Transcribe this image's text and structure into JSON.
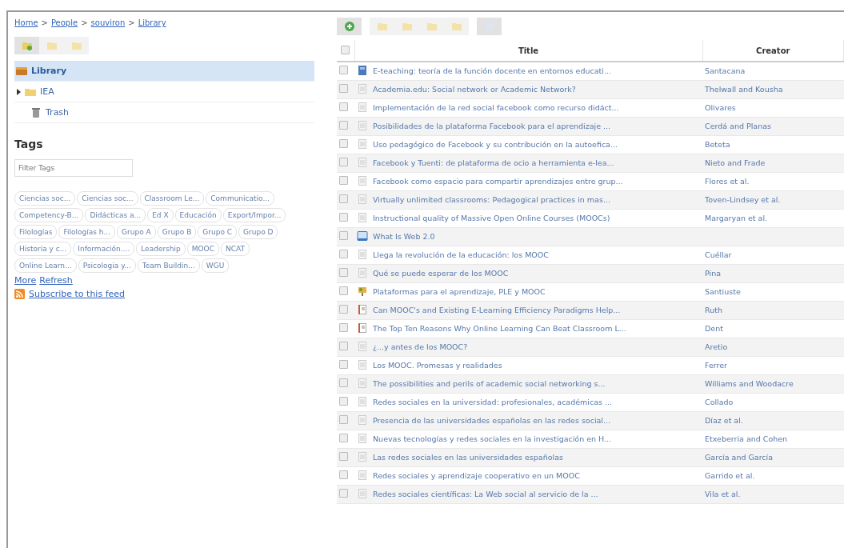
{
  "breadcrumb": {
    "separator": ">",
    "links": [
      "Home",
      "People",
      "souviron",
      "Library"
    ]
  },
  "collections": [
    {
      "label": "Library",
      "kind": "library",
      "selected": true,
      "expandable": false
    },
    {
      "label": "IEA",
      "kind": "folder",
      "selected": false,
      "expandable": true
    },
    {
      "label": "Trash",
      "kind": "trash",
      "selected": false,
      "expandable": false
    }
  ],
  "tags": {
    "heading": "Tags",
    "filter": {
      "placeholder": "Filter Tags"
    },
    "items": [
      "Ciencias soc...",
      "Ciencias soc...",
      "Classroom Le...",
      "Communicatio...",
      "Competency-B...",
      "Didácticas a...",
      "Ed X",
      "Educación",
      "Export/Impor...",
      "Filologías",
      "Filologías h...",
      "Grupo A",
      "Grupo B",
      "Grupo C",
      "Grupo D",
      "Historia y c...",
      "Información....",
      "Leadership",
      "MOOC",
      "NCAT",
      "Online Learn...",
      "Psicologia y...",
      "Team Buildin...",
      "WGU"
    ],
    "links": [
      "More",
      "Refresh"
    ],
    "feed": "Subscribe to this feed"
  },
  "table": {
    "columns": [
      "Title",
      "Creator"
    ],
    "select_all_checked": false,
    "rows": [
      {
        "checked": false,
        "kind": "book",
        "title": "E-teaching: teoría de la función docente en entornos educati...",
        "creator": "Santacana"
      },
      {
        "checked": false,
        "kind": "article",
        "title": "Academia.edu: Social network or Academic Network?",
        "creator": "Thelwall and Kousha"
      },
      {
        "checked": false,
        "kind": "article",
        "title": "Implementación de la red social facebook como recurso didáct...",
        "creator": "Olivares"
      },
      {
        "checked": false,
        "kind": "article",
        "title": "Posibilidades de la plataforma Facebook para el aprendizaje ...",
        "creator": "Cerdá and Planas"
      },
      {
        "checked": false,
        "kind": "article",
        "title": "Uso pedagógico de Facebook y su contribución en la autoefica...",
        "creator": "Beteta"
      },
      {
        "checked": false,
        "kind": "article",
        "title": "Facebook y Tuenti: de plataforma de ocio a herramienta e-lea...",
        "creator": "Nieto and Frade"
      },
      {
        "checked": false,
        "kind": "article",
        "title": "Facebook como espacio para compartir aprendizajes entre grup...",
        "creator": "Flores et al."
      },
      {
        "checked": false,
        "kind": "article",
        "title": "Virtually unlimited classrooms: Pedagogical practices in mas...",
        "creator": "Toven-Lindsey et al."
      },
      {
        "checked": false,
        "kind": "article",
        "title": "Instructional quality of Massive Open Online Courses (MOOCs)",
        "creator": "Margaryan et al."
      },
      {
        "checked": false,
        "kind": "webpage",
        "title": "What Is Web 2.0"
      },
      {
        "checked": false,
        "kind": "article",
        "title": "Llega la revolución de la educación: los MOOC",
        "creator": "Cuéllar"
      },
      {
        "checked": false,
        "kind": "article",
        "title": "Qué se puede esperar de los MOOC",
        "creator": "Pina"
      },
      {
        "checked": false,
        "kind": "presentation",
        "title": "Plataformas para el aprendizaje, PLE y MOOC",
        "creator": "Santiuste"
      },
      {
        "checked": false,
        "kind": "report",
        "title": "Can MOOC's and Existing E-Learning Efficiency Paradigms Help...",
        "creator": "Ruth"
      },
      {
        "checked": false,
        "kind": "report",
        "title": "The Top Ten Reasons Why Online Learning Can Beat Classroom L...",
        "creator": "Dent"
      },
      {
        "checked": false,
        "kind": "article",
        "title": "¿...y antes de los MOOC?",
        "creator": "Aretio"
      },
      {
        "checked": false,
        "kind": "article",
        "title": "Los MOOC. Promesas y realidades",
        "creator": "Ferrer"
      },
      {
        "checked": false,
        "kind": "article",
        "title": "The possibilities and perils of academic social networking s...",
        "creator": "Williams and Woodacre"
      },
      {
        "checked": false,
        "kind": "article",
        "title": "Redes sociales en la universidad: profesionales, académicas ...",
        "creator": "Collado"
      },
      {
        "checked": false,
        "kind": "article",
        "title": "Presencia de las universidades españolas en las redes social...",
        "creator": "Díaz et al."
      },
      {
        "checked": false,
        "kind": "article",
        "title": "Nuevas tecnologías y redes sociales en la investigación en H...",
        "creator": "Etxeberria and Cohen"
      },
      {
        "checked": false,
        "kind": "article",
        "title": "Las redes sociales en las universidades españolas",
        "creator": "García and García"
      },
      {
        "checked": false,
        "kind": "article",
        "title": "Redes sociales y aprendizaje cooperativo en un MOOC",
        "creator": "Garrido et al."
      },
      {
        "checked": false,
        "kind": "article",
        "title": "Redes sociales científicas: La Web social al servicio de la ...",
        "creator": "Vila et al."
      }
    ]
  }
}
